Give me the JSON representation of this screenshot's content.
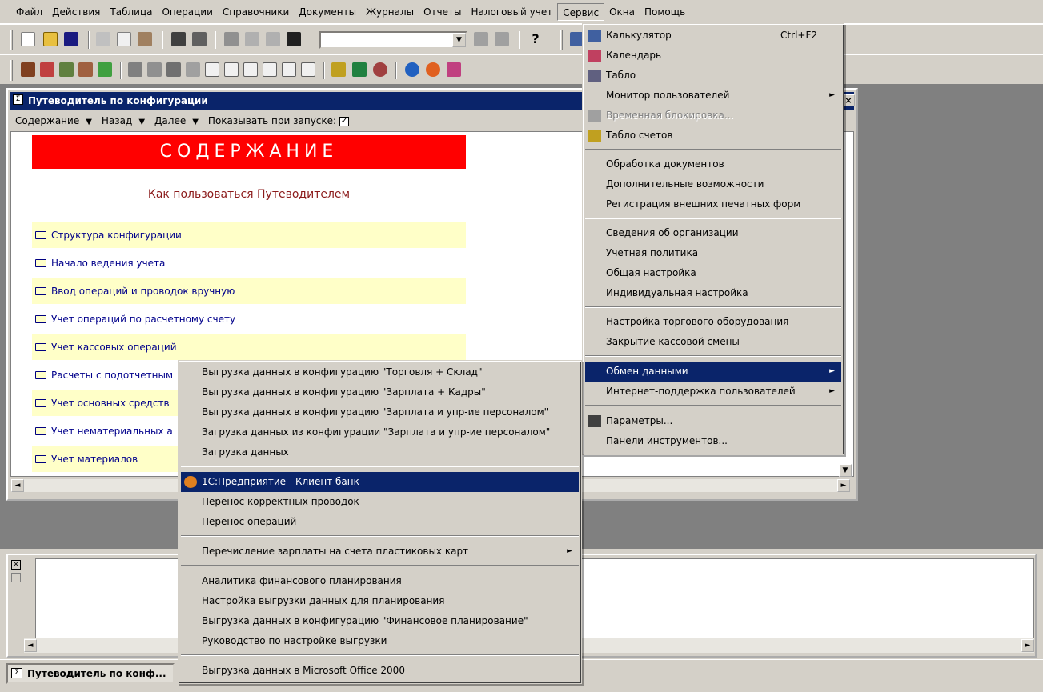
{
  "menubar": {
    "items": [
      "Файл",
      "Действия",
      "Таблица",
      "Операции",
      "Справочники",
      "Документы",
      "Журналы",
      "Отчеты",
      "Налоговый учет",
      "Сервис",
      "Окна",
      "Помощь"
    ]
  },
  "guide": {
    "title": "Путеводитель по конфигурации",
    "nav": {
      "contents": "Содержание",
      "back": "Назад",
      "forward": "Далее",
      "show_on_start": "Показывать при запуске:"
    },
    "banner": "СОДЕРЖАНИЕ",
    "howto": "Как пользоваться Путеводителем",
    "toc": [
      "Структура конфигурации",
      "Начало ведения учета",
      "Ввод операций и проводок вручную",
      "Учет операций по расчетному счету",
      "Учет кассовых операций",
      "Расчеты с подотчетным",
      "Учет основных средств",
      "Учет нематериальных а",
      "Учет материалов"
    ]
  },
  "servis_menu": {
    "items": [
      {
        "label": "Калькулятор",
        "shortcut": "Ctrl+F2"
      },
      {
        "label": "Календарь"
      },
      {
        "label": "Табло"
      },
      {
        "label": "Монитор пользователей"
      },
      {
        "label": "Временная блокировка..."
      },
      {
        "label": "Табло счетов"
      },
      {
        "label": "Обработка документов"
      },
      {
        "label": "Дополнительные возможности"
      },
      {
        "label": "Регистрация внешних печатных форм"
      },
      {
        "label": "Сведения об организации"
      },
      {
        "label": "Учетная политика"
      },
      {
        "label": "Общая настройка"
      },
      {
        "label": "Индивидуальная настройка"
      },
      {
        "label": "Настройка торгового оборудования"
      },
      {
        "label": "Закрытие кассовой смены"
      },
      {
        "label": "Обмен данными"
      },
      {
        "label": "Интернет-поддержка пользователей"
      },
      {
        "label": "Параметры..."
      },
      {
        "label": "Панели инструментов..."
      }
    ]
  },
  "exchange_menu": {
    "items": [
      "Выгрузка данных в конфигурацию \"Торговля + Склад\"",
      "Выгрузка данных в конфигурацию \"Зарплата + Кадры\"",
      "Выгрузка данных в конфигурацию \"Зарплата и упр-ие персоналом\"",
      "Загрузка данных из конфигурации \"Зарплата и упр-ие персоналом\"",
      "Загрузка данных",
      "1С:Предприятие - Клиент банк",
      "Перенос корректных проводок",
      "Перенос операций",
      "Перечисление зарплаты на счета пластиковых карт",
      "Аналитика финансового планирования",
      "Настройка выгрузки данных для планирования",
      "Выгрузка данных в конфигурацию \"Финансовое планирование\"",
      "Руководство по настройке выгрузки",
      "Выгрузка данных в Microsoft Office 2000"
    ]
  },
  "taskbar": {
    "window_label": "Путеводитель по конф..."
  },
  "colors": {
    "title_bar": "#0a246a",
    "banner": "#ff0000",
    "toc_highlight": "#ffffc8"
  }
}
